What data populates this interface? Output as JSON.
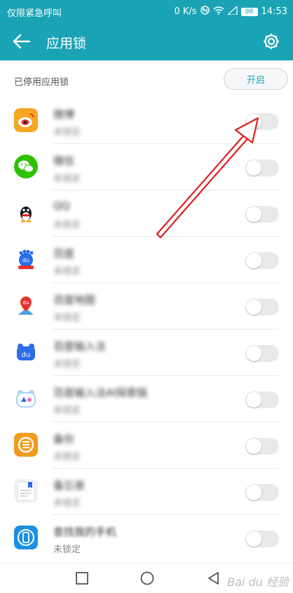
{
  "status_bar": {
    "carrier": "仅限紧急呼叫",
    "speed": "0 K/s",
    "battery": "98",
    "time": "14:53"
  },
  "app_bar": {
    "title": "应用锁"
  },
  "section": {
    "label": "已停用应用锁",
    "enable_button": "开启"
  },
  "apps": [
    {
      "name": "微博",
      "status": "未锁定",
      "icon": "weibo-icon",
      "locked": false
    },
    {
      "name": "微信",
      "status": "未锁定",
      "icon": "wechat-icon",
      "locked": false
    },
    {
      "name": "QQ",
      "status": "未锁定",
      "icon": "qq-icon",
      "locked": false
    },
    {
      "name": "百度",
      "status": "未锁定",
      "icon": "baidu-icon",
      "locked": false
    },
    {
      "name": "百度地图",
      "status": "未锁定",
      "icon": "baidu-map-icon",
      "locked": false
    },
    {
      "name": "百度输入法",
      "status": "未锁定",
      "icon": "baidu-input-icon",
      "locked": false
    },
    {
      "name": "百度输入法AI探索版",
      "status": "未锁定",
      "icon": "baidu-input-ai-icon",
      "locked": false
    },
    {
      "name": "备份",
      "status": "未锁定",
      "icon": "backup-icon",
      "locked": false
    },
    {
      "name": "备忘录",
      "status": "未锁定",
      "icon": "memo-icon",
      "locked": false
    },
    {
      "name": "查找我的手机",
      "status": "未锁定",
      "icon": "find-phone-icon",
      "locked": false
    }
  ],
  "watermark": "Bai du 经验",
  "colors": {
    "accent": "#1aa3b5",
    "annotation": "#e02020"
  }
}
